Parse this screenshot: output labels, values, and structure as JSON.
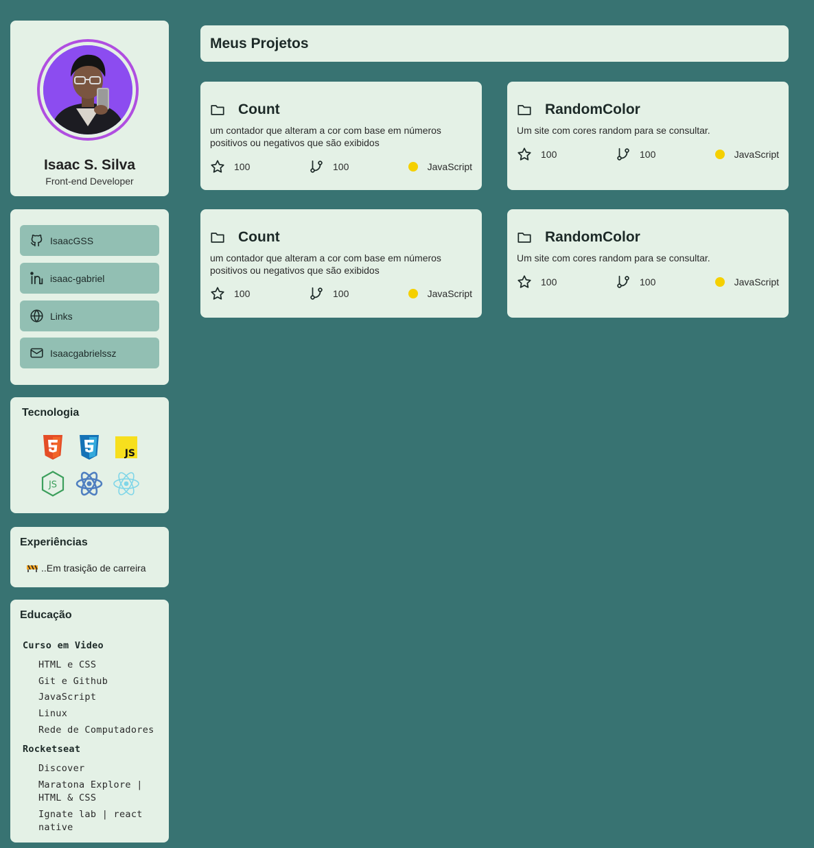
{
  "profile": {
    "name": "Isaac S. Silva",
    "role": "Front-end Developer"
  },
  "social": {
    "items": [
      {
        "icon": "github-icon",
        "label": "IsaacGSS"
      },
      {
        "icon": "linkedin-icon",
        "label": "isaac-gabriel"
      },
      {
        "icon": "globe-icon",
        "label": "Links"
      },
      {
        "icon": "mail-icon",
        "label": "Isaacgabrielssz"
      }
    ]
  },
  "tech": {
    "title": "Tecnologia",
    "icons": [
      "html5-icon",
      "css3-icon",
      "javascript-icon",
      "nodejs-icon",
      "react-icon",
      "react-native-icon"
    ]
  },
  "experience": {
    "title": "Experiências",
    "text": "..Em trasição de carreira"
  },
  "education": {
    "title": "Educação",
    "groups": [
      {
        "name": "Curso em Video",
        "items": [
          "HTML e CSS",
          "Git e Github",
          "JavaScript",
          "Linux",
          "Rede de Computadores"
        ]
      },
      {
        "name": "Rocketseat",
        "items": [
          "Discover",
          "Maratona Explore | HTML & CSS",
          "Ignate lab | react native"
        ]
      }
    ]
  },
  "main": {
    "title": "Meus Projetos",
    "repos": [
      {
        "name": "Count",
        "description": "um contador que alteram a cor com base em números positivos ou negativos que são exibidos",
        "stars": "100",
        "forks": "100",
        "language": "JavaScript"
      },
      {
        "name": "RandomColor",
        "description": "Um site com cores random para se consultar.",
        "stars": "100",
        "forks": "100",
        "language": "JavaScript"
      },
      {
        "name": "Count",
        "description": "um contador que alteram a cor com base em números positivos ou negativos que são exibidos",
        "stars": "100",
        "forks": "100",
        "language": "JavaScript"
      },
      {
        "name": "RandomColor",
        "description": "Um site com cores random para se consultar.",
        "stars": "100",
        "forks": "100",
        "language": "JavaScript"
      }
    ]
  },
  "colors": {
    "background": "#387372",
    "card": "#e4f1e6",
    "social_button": "#92bfb3",
    "avatar_ring": "#b04ee0",
    "avatar_bg": "#8c4cf0",
    "language_dot": "#f5d000"
  }
}
